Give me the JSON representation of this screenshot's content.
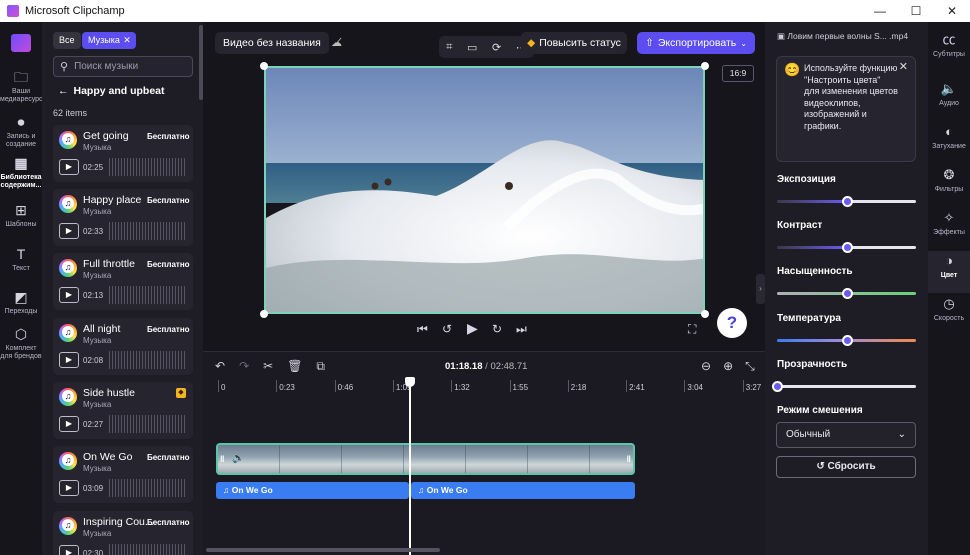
{
  "window": {
    "title": "Microsoft Clipchamp",
    "controls": [
      "—",
      "☐",
      "✕"
    ]
  },
  "leftnav": [
    {
      "icon": "folder-icon",
      "glyph": "🗀",
      "label": "Ваши медиаресурсы"
    },
    {
      "icon": "video-camera-icon",
      "glyph": "⏺",
      "label": "Запись и создание"
    },
    {
      "icon": "library-icon",
      "glyph": "▦",
      "label": "Библиотека содержим...",
      "active": true
    },
    {
      "icon": "templates-icon",
      "glyph": "⊞",
      "label": "Шаблоны"
    },
    {
      "icon": "text-icon",
      "glyph": "T",
      "label": "Текст"
    },
    {
      "icon": "transitions-icon",
      "glyph": "◩",
      "label": "Переходы"
    },
    {
      "icon": "brand-kit-icon",
      "glyph": "⬡",
      "label": "Комплект для брендов"
    }
  ],
  "music": {
    "chips": [
      "Все",
      "Музыка"
    ],
    "search_placeholder": "Поиск музыки",
    "back_label": "Happy and upbeat",
    "count": "62 items",
    "items": [
      {
        "name": "Get going",
        "category": "Музыка",
        "badge": "Бесплатно",
        "duration": "02:25"
      },
      {
        "name": "Happy place",
        "category": "Музыка",
        "badge": "Бесплатно",
        "duration": "02:33"
      },
      {
        "name": "Full throttle",
        "category": "Музыка",
        "badge": "Бесплатно",
        "duration": "02:13"
      },
      {
        "name": "All night",
        "category": "Музыка",
        "badge": "Бесплатно",
        "duration": "02:08"
      },
      {
        "name": "Side hustle",
        "category": "Музыка",
        "badge": "",
        "premium": true,
        "duration": "02:27"
      },
      {
        "name": "On We Go",
        "category": "Музыка",
        "badge": "Бесплатно",
        "duration": "03:09"
      },
      {
        "name": "Inspiring Cou...",
        "category": "Музыка",
        "badge": "Бесплатно",
        "duration": "02:30"
      }
    ]
  },
  "stage": {
    "project_title": "Видео без названия",
    "upgrade_label": "Повысить статус",
    "export_label": "Экспортировать",
    "aspect_ratio": "16:9",
    "help": "?"
  },
  "timeline": {
    "current_time": "01:18.18",
    "total_time": "02:48.71",
    "ticks": [
      "0",
      "0:23",
      "0:46",
      "1:09",
      "1:32",
      "1:55",
      "2:18",
      "2:41",
      "3:04",
      "3:27"
    ],
    "audio_clips": [
      "On We Go",
      "On We Go"
    ]
  },
  "properties": {
    "file_name": "Ловим первые волны S... .mp4",
    "tip": "Используйте функцию \"Настроить цвета\" для изменения цветов видеоклипов, изображений и графики.",
    "sliders": [
      {
        "label": "Экспозиция",
        "value": 0.5
      },
      {
        "label": "Контраст",
        "value": 0.5
      },
      {
        "label": "Насыщенность",
        "value": 0.5
      },
      {
        "label": "Температура",
        "value": 0.5
      },
      {
        "label": "Прозрачность",
        "value": 0.0
      }
    ],
    "blend_label": "Режим смешения",
    "blend_value": "Обычный",
    "reset_label": "Сбросить"
  },
  "rightnav": [
    {
      "icon": "captions-icon",
      "glyph": "㏄",
      "label": "Субтитры"
    },
    {
      "icon": "audio-icon",
      "glyph": "🔈",
      "label": "Аудио"
    },
    {
      "icon": "fade-icon",
      "glyph": "◐",
      "label": "Затухание"
    },
    {
      "icon": "filters-icon",
      "glyph": "❂",
      "label": "Фильтры"
    },
    {
      "icon": "effects-icon",
      "glyph": "✧",
      "label": "Эффекты"
    },
    {
      "icon": "color-icon",
      "glyph": "◑",
      "label": "Цвет",
      "active": true
    },
    {
      "icon": "speed-icon",
      "glyph": "◷",
      "label": "Скорость"
    }
  ]
}
